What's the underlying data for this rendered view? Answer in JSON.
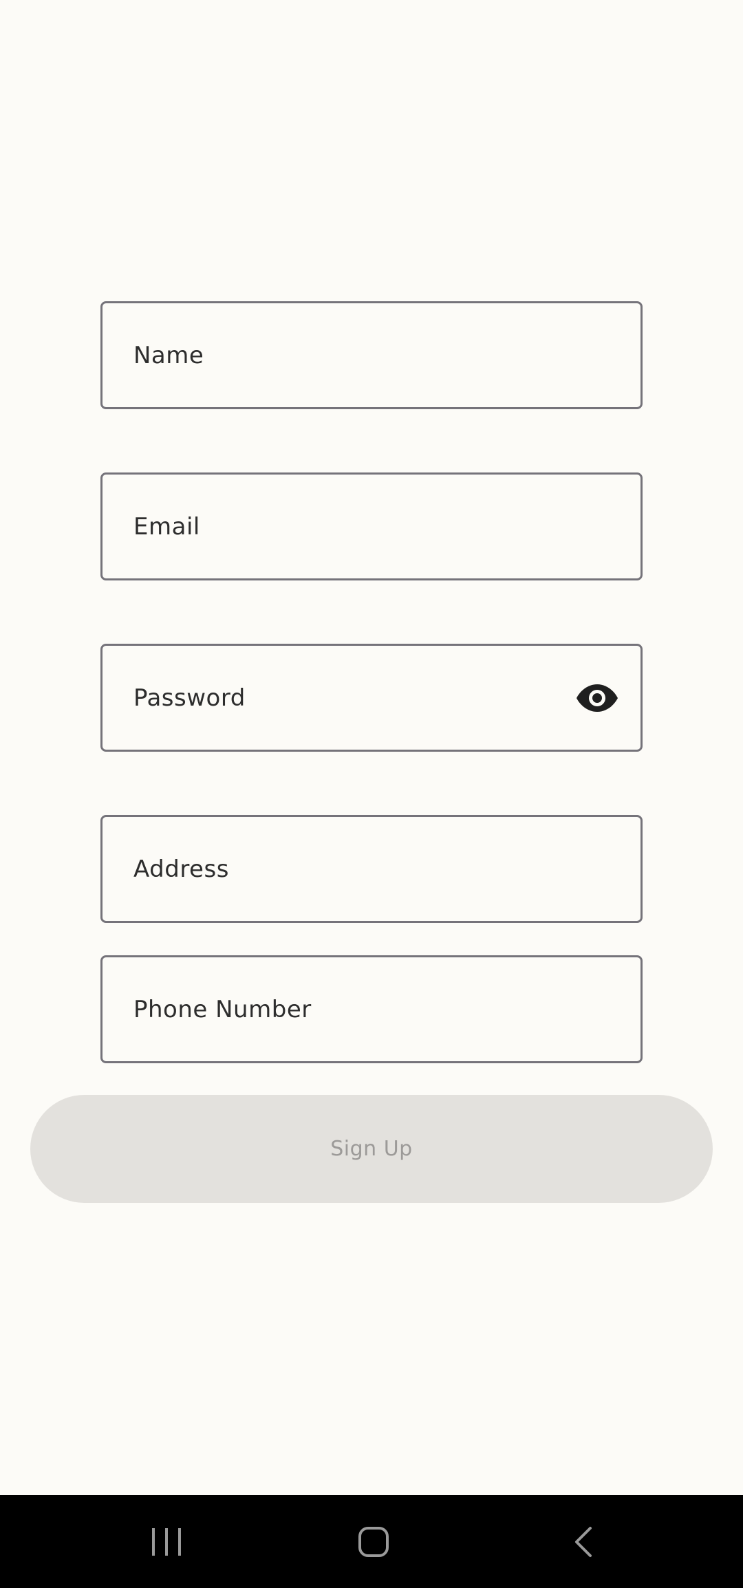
{
  "form": {
    "name_placeholder": "Name",
    "email_placeholder": "Email",
    "password_placeholder": "Password",
    "address_placeholder": "Address",
    "phone_placeholder": "Phone Number",
    "password_toggle_icon": "eye-icon"
  },
  "signup": {
    "label": "Sign Up"
  },
  "navbar": {
    "recent_icon": "recent-apps-icon",
    "home_icon": "home-icon",
    "back_icon": "back-icon"
  },
  "colors": {
    "background": "#fcfbf7",
    "field_border": "#75737a",
    "button_disabled_bg": "#e3e1dd",
    "button_disabled_text": "#9c9a98",
    "navbar_bg": "#000000"
  }
}
